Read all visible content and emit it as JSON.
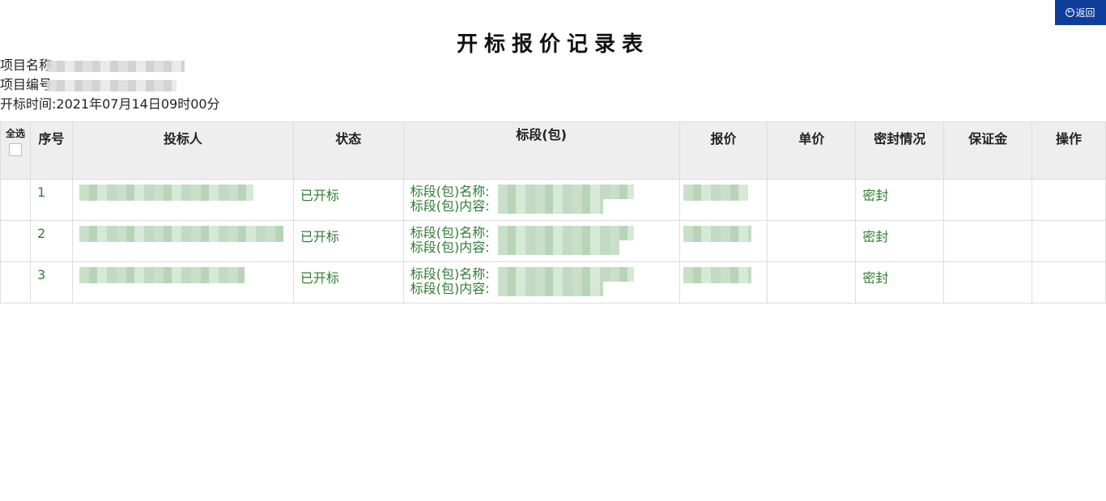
{
  "header": {
    "back_label": "返回",
    "back_icon": "arrow-left-circle-icon",
    "title": "开标报价记录表"
  },
  "info": {
    "project_name_label": "项目名称",
    "project_code_label": "项目编号",
    "open_time": "开标时间:2021年07月14日09时00分"
  },
  "table": {
    "headers": {
      "select_all": "全选",
      "no": "序号",
      "bidder": "投标人",
      "status": "状态",
      "section": "标段(包)",
      "price": "报价",
      "unit_price": "单价",
      "seal": "密封情况",
      "deposit": "保证金",
      "operation": "操作"
    },
    "rows": [
      {
        "no": "1",
        "status": "已开标",
        "section_name_label": "标段(包)名称:",
        "section_content_label": "标段(包)内容:",
        "seal": "密封"
      },
      {
        "no": "2",
        "status": "已开标",
        "section_name_label": "标段(包)名称:",
        "section_content_label": "标段(包)内容:",
        "seal": "密封"
      },
      {
        "no": "3",
        "status": "已开标",
        "section_name_label": "标段(包)名称:",
        "section_content_label": "标段(包)内容:",
        "seal": "密封"
      }
    ]
  },
  "colors": {
    "accent": "#0d3f9a",
    "row_text": "#2e7d32",
    "header_bg": "#eeeeee"
  }
}
